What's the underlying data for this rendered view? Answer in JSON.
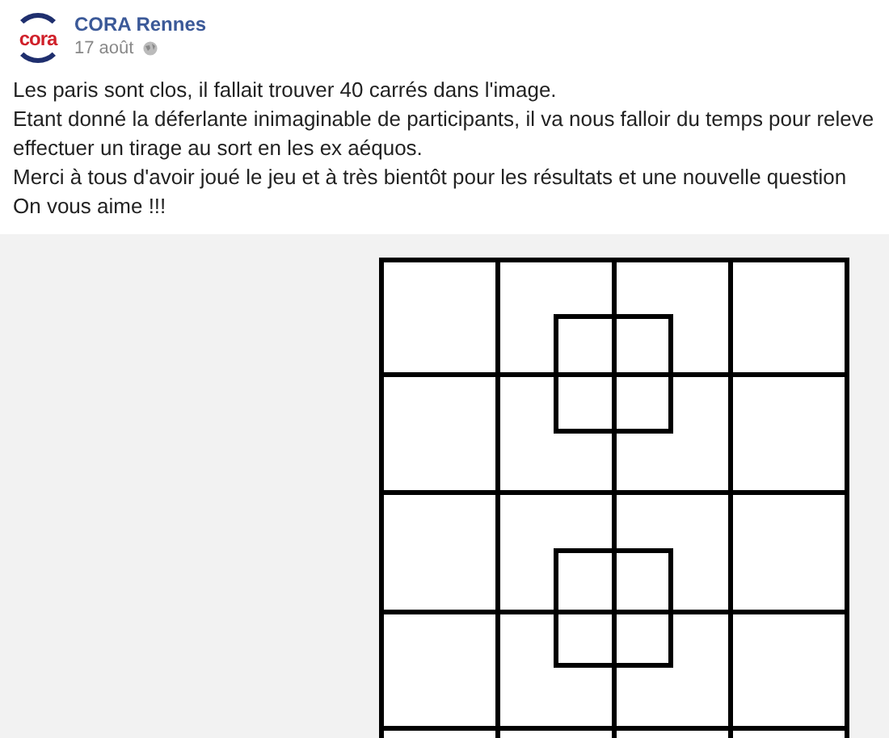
{
  "post": {
    "logo_text": "cora",
    "author": "CORA Rennes",
    "date": "17 août",
    "lines": [
      "Les paris sont clos, il fallait trouver 40 carrés dans l'image.",
      "Etant donné la déferlante inimaginable de participants, il va nous falloir du temps pour releve",
      "effectuer un tirage au sort en les ex aéquos.",
      "Merci à tous d'avoir joué le jeu et à très bientôt pour les résultats et une nouvelle question",
      "On vous aime !!!"
    ]
  }
}
